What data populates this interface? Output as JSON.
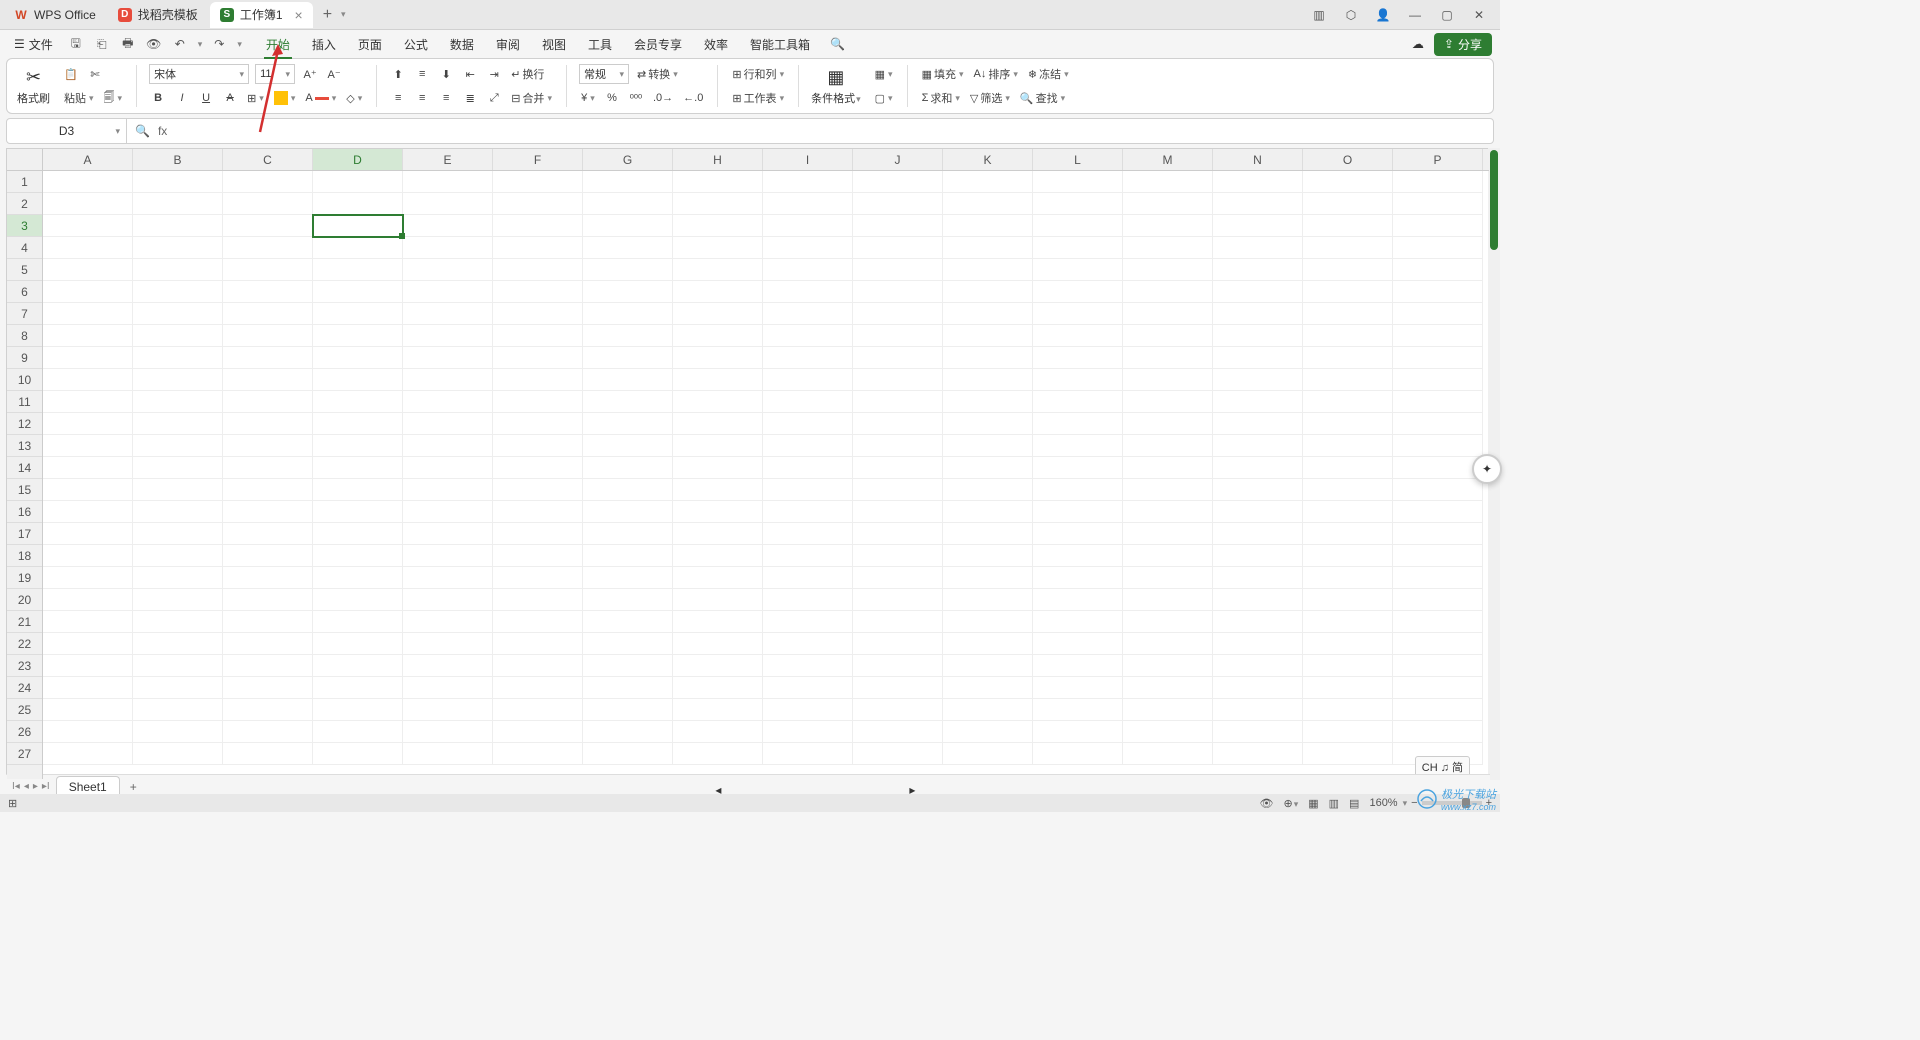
{
  "titlebar": {
    "tabs": [
      {
        "icon": "W",
        "label": "WPS Office"
      },
      {
        "icon": "D",
        "label": "找稻壳模板"
      },
      {
        "icon": "S",
        "label": "工作簿1"
      }
    ]
  },
  "menubar": {
    "file": "文件",
    "tabs": [
      "开始",
      "插入",
      "页面",
      "公式",
      "数据",
      "审阅",
      "视图",
      "工具",
      "会员专享",
      "效率",
      "智能工具箱"
    ],
    "active_tab": 0,
    "share": "分享"
  },
  "ribbon": {
    "format_painter": "格式刷",
    "paste": "粘贴",
    "font_name": "宋体",
    "font_size": "11",
    "wrap": "换行",
    "merge": "合并",
    "number_format": "常规",
    "convert": "转换",
    "rowcol": "行和列",
    "worksheet": "工作表",
    "cond_format": "条件格式",
    "fill": "填充",
    "sort": "排序",
    "freeze": "冻结",
    "sum": "求和",
    "filter": "筛选",
    "find": "查找"
  },
  "formula": {
    "cell_ref": "D3",
    "fx": "fx",
    "value": ""
  },
  "grid": {
    "columns": [
      "A",
      "B",
      "C",
      "D",
      "E",
      "F",
      "G",
      "H",
      "I",
      "J",
      "K",
      "L",
      "M",
      "N",
      "O",
      "P"
    ],
    "rows": 27,
    "selected": {
      "col": "D",
      "row": 3
    }
  },
  "sheets": {
    "active": "Sheet1"
  },
  "status": {
    "ime": "CH ♫ 简",
    "zoom": "160%",
    "watermark_site": "极光下载站",
    "watermark_url": "www.xz7.com"
  }
}
